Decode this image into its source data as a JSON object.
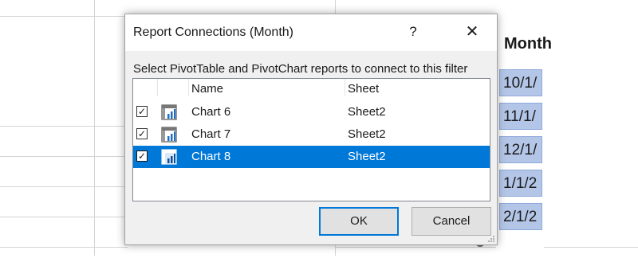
{
  "slicer": {
    "header": "Month",
    "items": [
      "10/1/",
      "11/1/",
      "12/1/",
      "1/1/2",
      "2/1/2"
    ]
  },
  "dialog": {
    "title": "Report Connections (Month)",
    "help_label": "?",
    "close_label": "✕",
    "instruction": "Select PivotTable and PivotChart reports to connect to this filter",
    "columns": [
      "Name",
      "Sheet"
    ],
    "rows": [
      {
        "checked": true,
        "name": "Chart 6",
        "sheet": "Sheet2",
        "selected": false
      },
      {
        "checked": true,
        "name": "Chart 7",
        "sheet": "Sheet2",
        "selected": false
      },
      {
        "checked": true,
        "name": "Chart 8",
        "sheet": "Sheet2",
        "selected": true
      }
    ],
    "ok_label": "OK",
    "cancel_label": "Cancel"
  },
  "icons": {
    "row_icon": "pivotchart-icon",
    "checkbox_mark": "✓"
  },
  "colors": {
    "selection": "#0078d7",
    "slicer_item": "#b4c6e7"
  }
}
